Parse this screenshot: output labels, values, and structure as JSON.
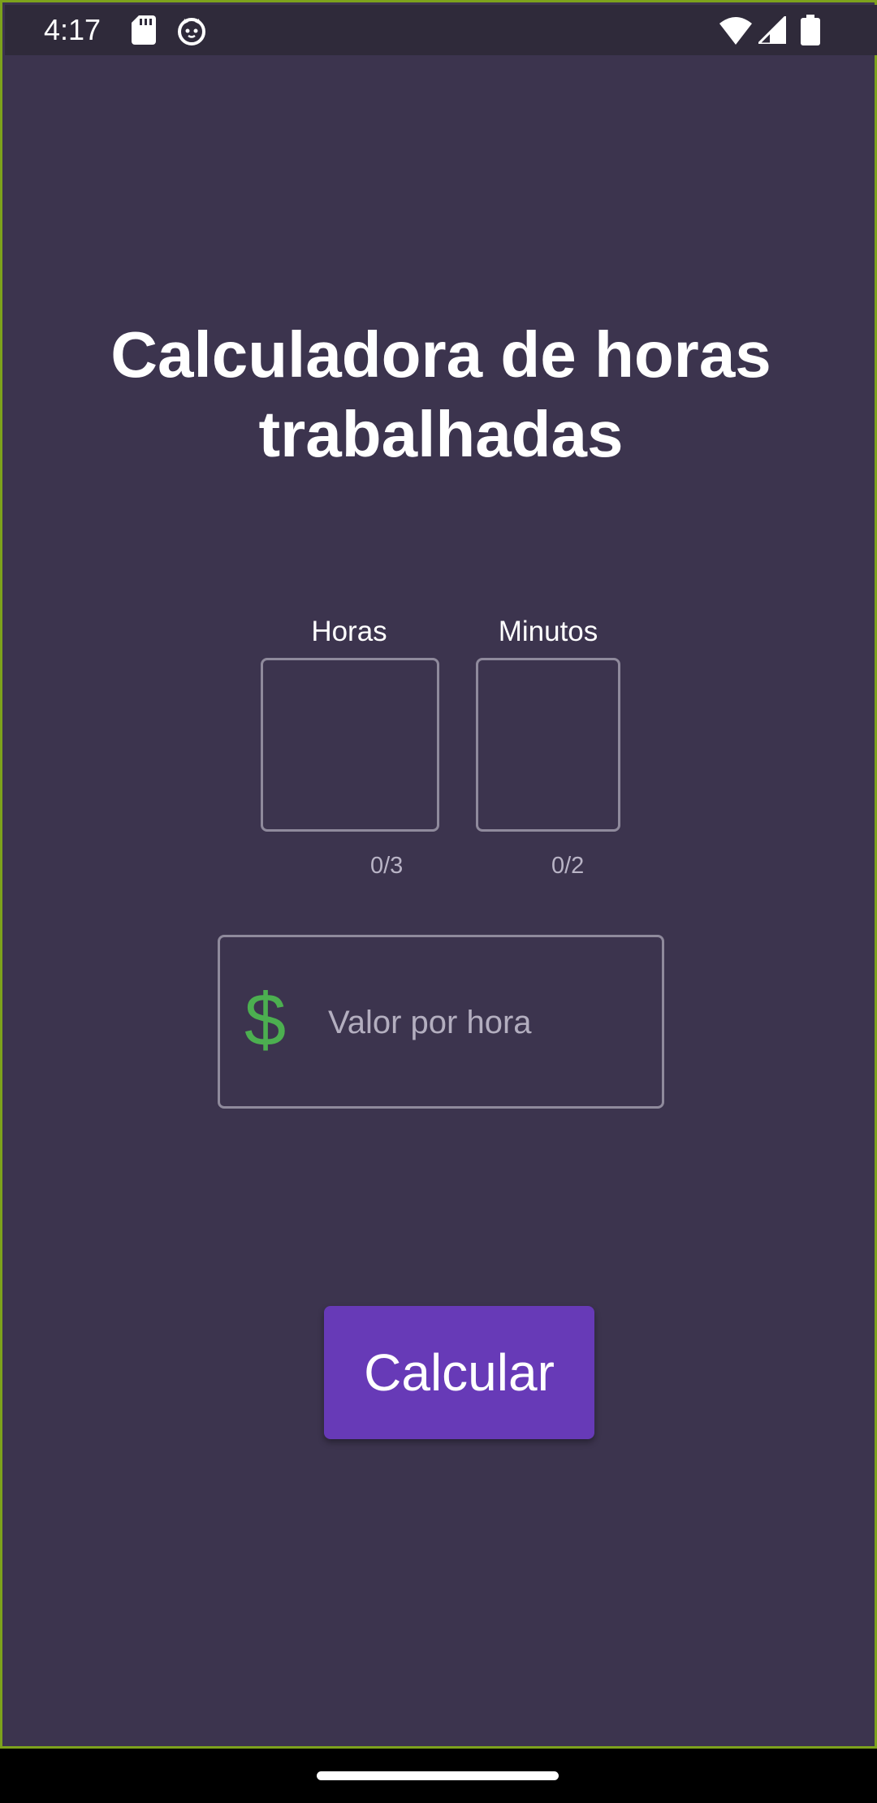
{
  "status_bar": {
    "time": "4:17",
    "icons": [
      "sd-card-icon",
      "cat-notification-icon",
      "wifi-icon",
      "signal-icon",
      "battery-icon"
    ]
  },
  "title": "Calculadora de horas trabalhadas",
  "fields": {
    "hours_label": "Horas",
    "minutes_label": "Minutos",
    "hours_counter": "0/3",
    "minutes_counter": "0/2",
    "rate_placeholder": "Valor por hora",
    "rate_icon": "dollar-icon"
  },
  "button": {
    "label": "Calcular"
  },
  "colors": {
    "background": "#3c344e",
    "status_bar": "#2f2a3a",
    "accent_button": "#673ab7",
    "dollar_icon": "#4caf50",
    "outline": "#8f8a9c",
    "frame_border": "#7da21c"
  }
}
